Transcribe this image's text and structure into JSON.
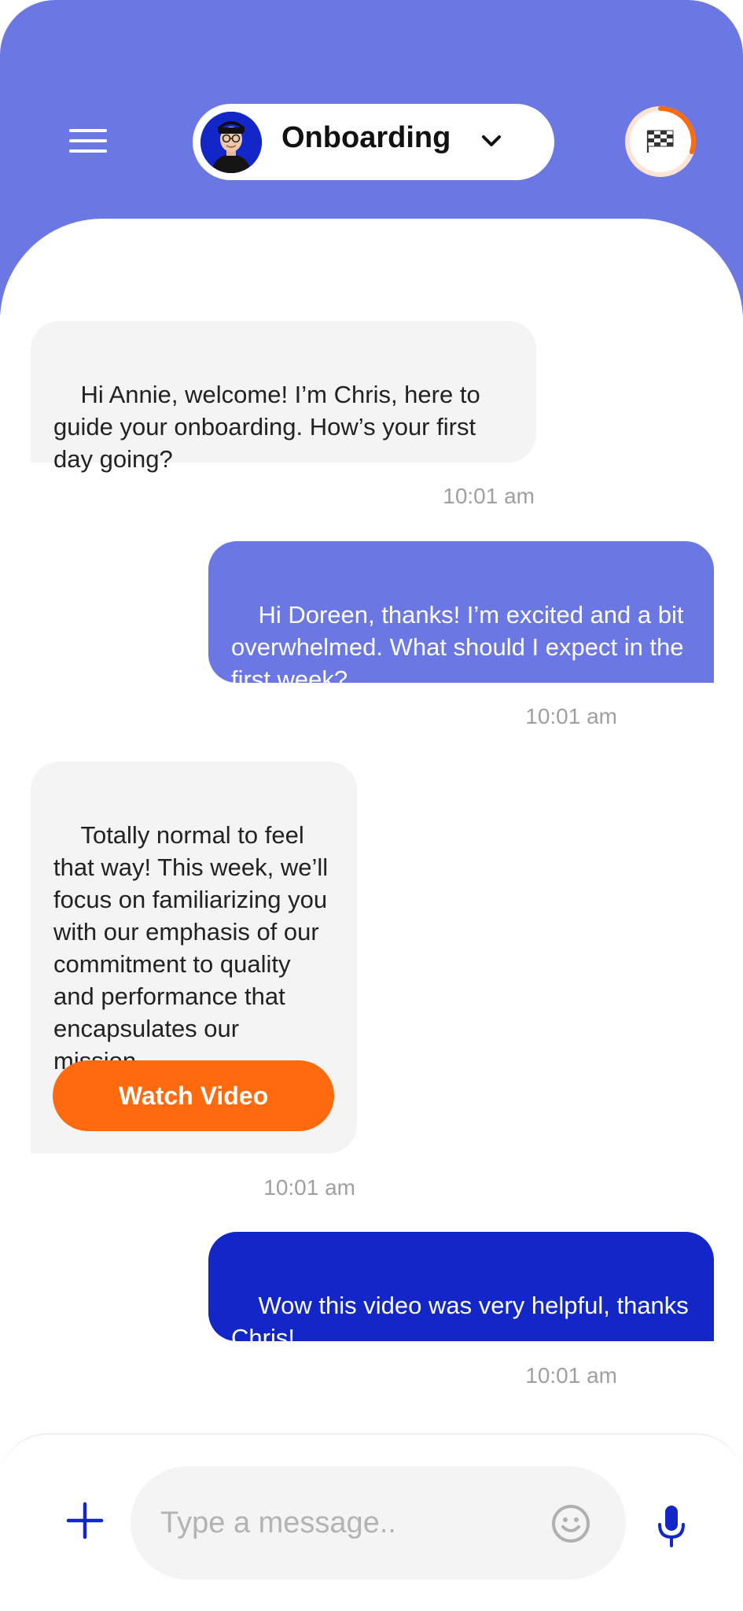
{
  "header": {
    "chat_title": "Onboarding",
    "icons": {
      "menu": "hamburger-menu-icon",
      "chevron": "chevron-down-icon",
      "progress": "checkered-flag-icon"
    },
    "progress_fraction": 0.3
  },
  "messages": [
    {
      "sender": "incoming",
      "text": "Hi Annie, welcome! I’m Chris, here to guide your onboarding. How’s your first day going?",
      "time": "10:01 am"
    },
    {
      "sender": "outgoing",
      "text": "Hi Doreen, thanks! I’m excited and a bit overwhelmed. What should I expect in the first week?",
      "time": "10:01 am"
    },
    {
      "sender": "incoming",
      "text": "Totally normal to feel that way! This week, we’ll focus on familiarizing you with our emphasis of our commitment to quality and performance that encapsulates our mission.",
      "time": "10:01 am",
      "button_label": "Watch Video"
    },
    {
      "sender": "outgoing",
      "text": "Wow this video was very helpful, thanks Chris!",
      "time": "10:01 am"
    }
  ],
  "composer": {
    "placeholder": "Type a message..",
    "value": "",
    "icons": {
      "add": "plus-icon",
      "emoji": "smiley-icon",
      "mic": "microphone-icon"
    }
  },
  "colors": {
    "header_bg": "#6B77E3",
    "outgoing_light": "#6B77E3",
    "outgoing_dark": "#1327C9",
    "incoming_bg": "#F4F4F4",
    "accent_orange": "#FF6A0E",
    "icon_blue": "#1327C9"
  }
}
